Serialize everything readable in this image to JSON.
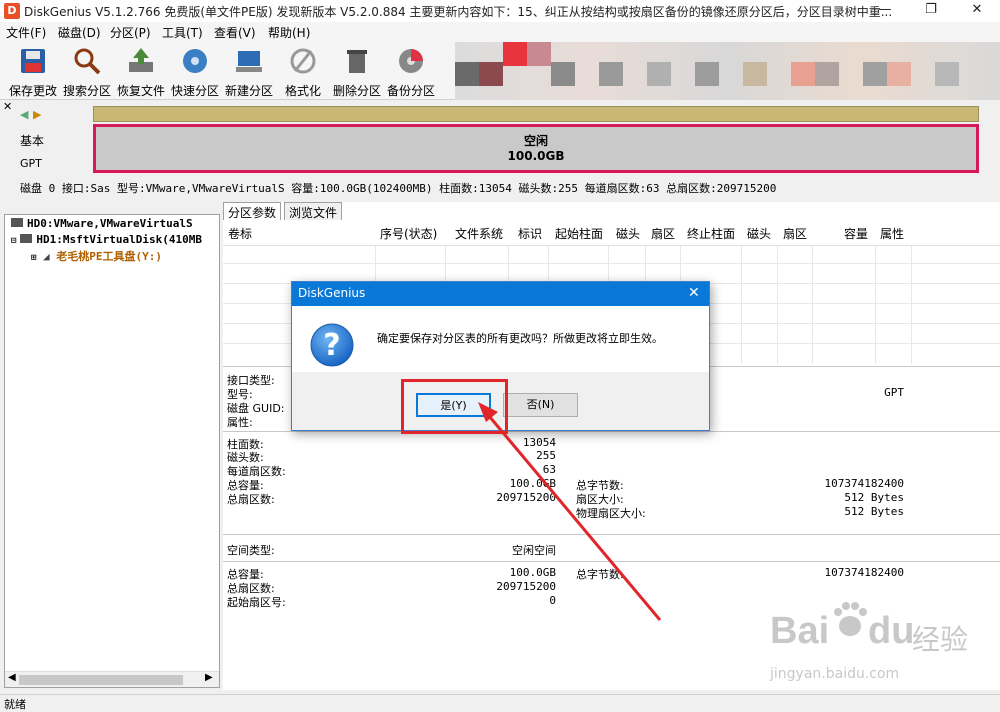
{
  "title": {
    "text": "DiskGenius V5.1.2.766 免费版(单文件PE版)    发现新版本 V5.2.0.884 主要更新内容如下：15、纠正从按结构或按扇区备份的镜像还原分区后，分区目录树中重..."
  },
  "menu": [
    "文件(F)",
    "磁盘(D)",
    "分区(P)",
    "工具(T)",
    "查看(V)",
    "帮助(H)"
  ],
  "toolbar": [
    {
      "label": "保存更改",
      "icon": "save-icon"
    },
    {
      "label": "搜索分区",
      "icon": "search-icon"
    },
    {
      "label": "恢复文件",
      "icon": "recover-icon"
    },
    {
      "label": "快速分区",
      "icon": "quick-partition-icon"
    },
    {
      "label": "新建分区",
      "icon": "new-partition-icon"
    },
    {
      "label": "格式化",
      "icon": "format-icon"
    },
    {
      "label": "删除分区",
      "icon": "delete-icon"
    },
    {
      "label": "备份分区",
      "icon": "backup-icon"
    }
  ],
  "disk": {
    "type": "基本",
    "style": "GPT",
    "partition_label": "空闲",
    "partition_size": "100.0GB",
    "info_line": "磁盘 0 接口:Sas  型号:VMware,VMwareVirtualS  容量:100.0GB(102400MB)  柱面数:13054  磁头数:255  每道扇区数:63  总扇区数:209715200"
  },
  "tree": {
    "items": [
      "HD0:VMware,VMwareVirtualS",
      "HD1:MsftVirtualDisk(410MB",
      "老毛桃PE工具盘(Y:)"
    ]
  },
  "tabs": [
    "分区参数",
    "浏览文件"
  ],
  "columns": [
    "卷标",
    "序号(状态)",
    "文件系统",
    "标识",
    "起始柱面",
    "磁头",
    "扇区",
    "终止柱面",
    "磁头",
    "扇区",
    "容量",
    "属性"
  ],
  "details": {
    "labels1": [
      "接口类型:",
      "型号:",
      "磁盘 GUID:",
      "属性:"
    ],
    "gpt": "GPT",
    "labels2": [
      "柱面数:",
      "磁头数:",
      "每道扇区数:",
      "总容量:",
      "总扇区数:"
    ],
    "values2": [
      "13054",
      "255",
      "63",
      "100.0GB",
      "209715200"
    ],
    "labels2r": [
      "总字节数:",
      "扇区大小:",
      "物理扇区大小:"
    ],
    "values2r": [
      "107374182400",
      "512 Bytes",
      "512 Bytes"
    ],
    "space_type_label": "空间类型:",
    "space_type_value": "空闲空间",
    "labels3": [
      "总容量:",
      "总扇区数:",
      "起始扇区号:"
    ],
    "values3": [
      "100.0GB",
      "209715200",
      "0"
    ],
    "label3r": "总字节数:",
    "value3r": "107374182400"
  },
  "dialog": {
    "title": "DiskGenius",
    "message": "确定要保存对分区表的所有更改吗？所做更改将立即生效。",
    "yes": "是(Y)",
    "no": "否(N)"
  },
  "status": "就绪",
  "watermark": {
    "brand": "Bai",
    "brand2": "du",
    "cn": "经验",
    "url": "jingyan.baidu.com"
  },
  "colors": {
    "highlight": "#d6195a",
    "title_blue": "#0a78d7"
  }
}
